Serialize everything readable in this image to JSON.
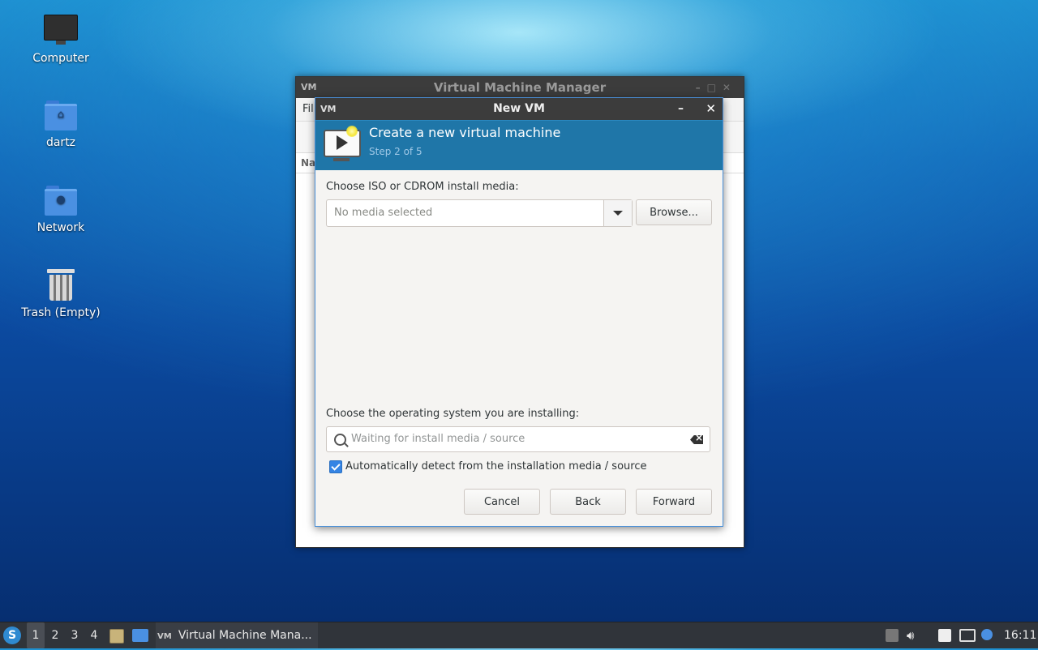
{
  "desktop": {
    "icons": [
      {
        "label": "Computer"
      },
      {
        "label": "dartz"
      },
      {
        "label": "Network"
      },
      {
        "label": "Trash (Empty)"
      }
    ]
  },
  "background_window": {
    "title": "Virtual Machine Manager",
    "logo": "VM",
    "menu_partial": "Fil",
    "column_partial": "Na"
  },
  "dialog": {
    "title": "New VM",
    "logo": "VM",
    "minimize": "–",
    "close": "✕",
    "header_title": "Create a new virtual machine",
    "header_step": "Step 2 of 5",
    "iso_label": "Choose ISO or CDROM install media:",
    "media_value": "No media selected",
    "browse_label": "Browse...",
    "os_label": "Choose the operating system you are installing:",
    "os_search_placeholder": "Waiting for install media / source",
    "auto_detect_label": "Automatically detect from the installation media / source",
    "auto_detect_checked": true,
    "cancel_label": "Cancel",
    "back_label": "Back",
    "forward_label": "Forward"
  },
  "taskbar": {
    "start_glyph": "S",
    "workspaces": [
      "1",
      "2",
      "3",
      "4"
    ],
    "task_label": "Virtual Machine Mana...",
    "task_logo": "VM",
    "clock": "16:11"
  }
}
